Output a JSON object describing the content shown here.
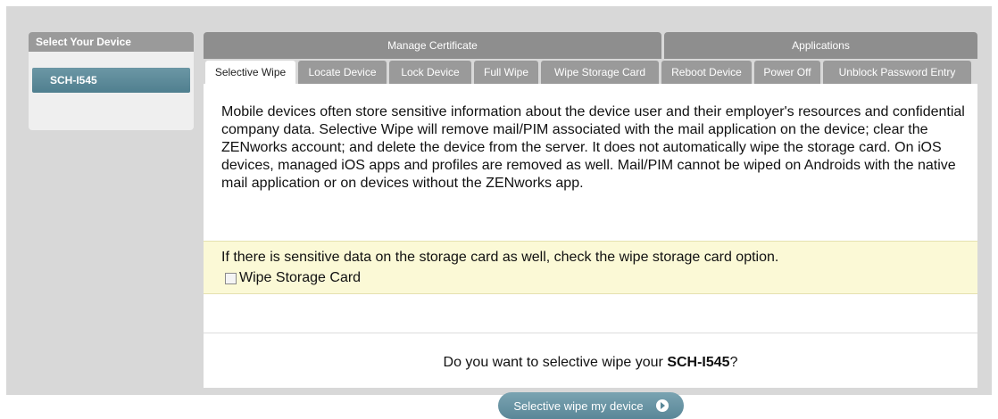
{
  "device_panel": {
    "header": "Select Your Device",
    "devices": [
      "SCH-I545"
    ]
  },
  "group_tabs": [
    {
      "label": "Manage Certificate"
    },
    {
      "label": "Applications"
    }
  ],
  "sub_tabs": [
    {
      "label": "Selective Wipe",
      "active": true
    },
    {
      "label": "Locate Device",
      "active": false
    },
    {
      "label": "Lock Device",
      "active": false
    },
    {
      "label": "Full Wipe",
      "active": false
    },
    {
      "label": "Wipe Storage Card",
      "active": false
    },
    {
      "label": "Reboot Device",
      "active": false
    },
    {
      "label": "Power Off",
      "active": false
    },
    {
      "label": "Unblock Password Entry",
      "active": false
    }
  ],
  "content": {
    "description": "Mobile devices often store sensitive information about the device user and their employer's resources and confidential company data. Selective Wipe will remove mail/PIM associated with the mail application on the device; clear the ZENworks account; and delete the device from the server. It does not automatically wipe the storage card. On iOS devices, managed iOS apps and profiles are removed as well. Mail/PIM cannot be wiped on Androids with the native mail application or on devices without the ZENworks app.",
    "notice": "If there is sensitive data on the storage card as well, check the wipe storage card option.",
    "checkbox_label": "Wipe Storage Card",
    "checkbox_checked": false,
    "question_prefix": "Do you want to selective wipe your ",
    "question_device": "SCH-I545",
    "question_suffix": "?",
    "button_label": "Selective wipe my device",
    "button_icon": "arrow-right-circle-icon"
  },
  "colors": {
    "tab_gray": "#9a9a9a",
    "device_accent": "#5a8798",
    "notice_bg": "#fbf9d6"
  }
}
